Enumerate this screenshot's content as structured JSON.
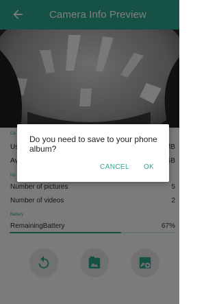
{
  "app_bar": {
    "title": "Camera Info Preview"
  },
  "preview": {
    "description_icon": "camera-ceiling-view"
  },
  "info": {
    "storage_section_label": "Ca",
    "used_space_label": "Us",
    "used_space_value": "MB",
    "available_space_label": "Av",
    "available_space_value": "GB",
    "media_section_label": "Nu",
    "pictures_label": "Number of pictures",
    "pictures_value": "5",
    "videos_label": "Number of videos",
    "videos_value": "2",
    "battery_section_label": "Battery",
    "battery_label": "RemainingBattery",
    "battery_value": "67%",
    "battery_level": 0.67
  },
  "actions": {
    "items": [
      {
        "name": "refresh",
        "icon": "refresh-icon"
      },
      {
        "name": "album",
        "icon": "album-icon"
      },
      {
        "name": "settings",
        "icon": "image-settings-icon"
      }
    ]
  },
  "dialog": {
    "message": "Do you need to save to your phone album?",
    "cancel_label": "CANCEL",
    "ok_label": "OK"
  },
  "colors": {
    "accent": "#2ba58a",
    "scrim": "rgba(0,0,0,0.5)"
  }
}
